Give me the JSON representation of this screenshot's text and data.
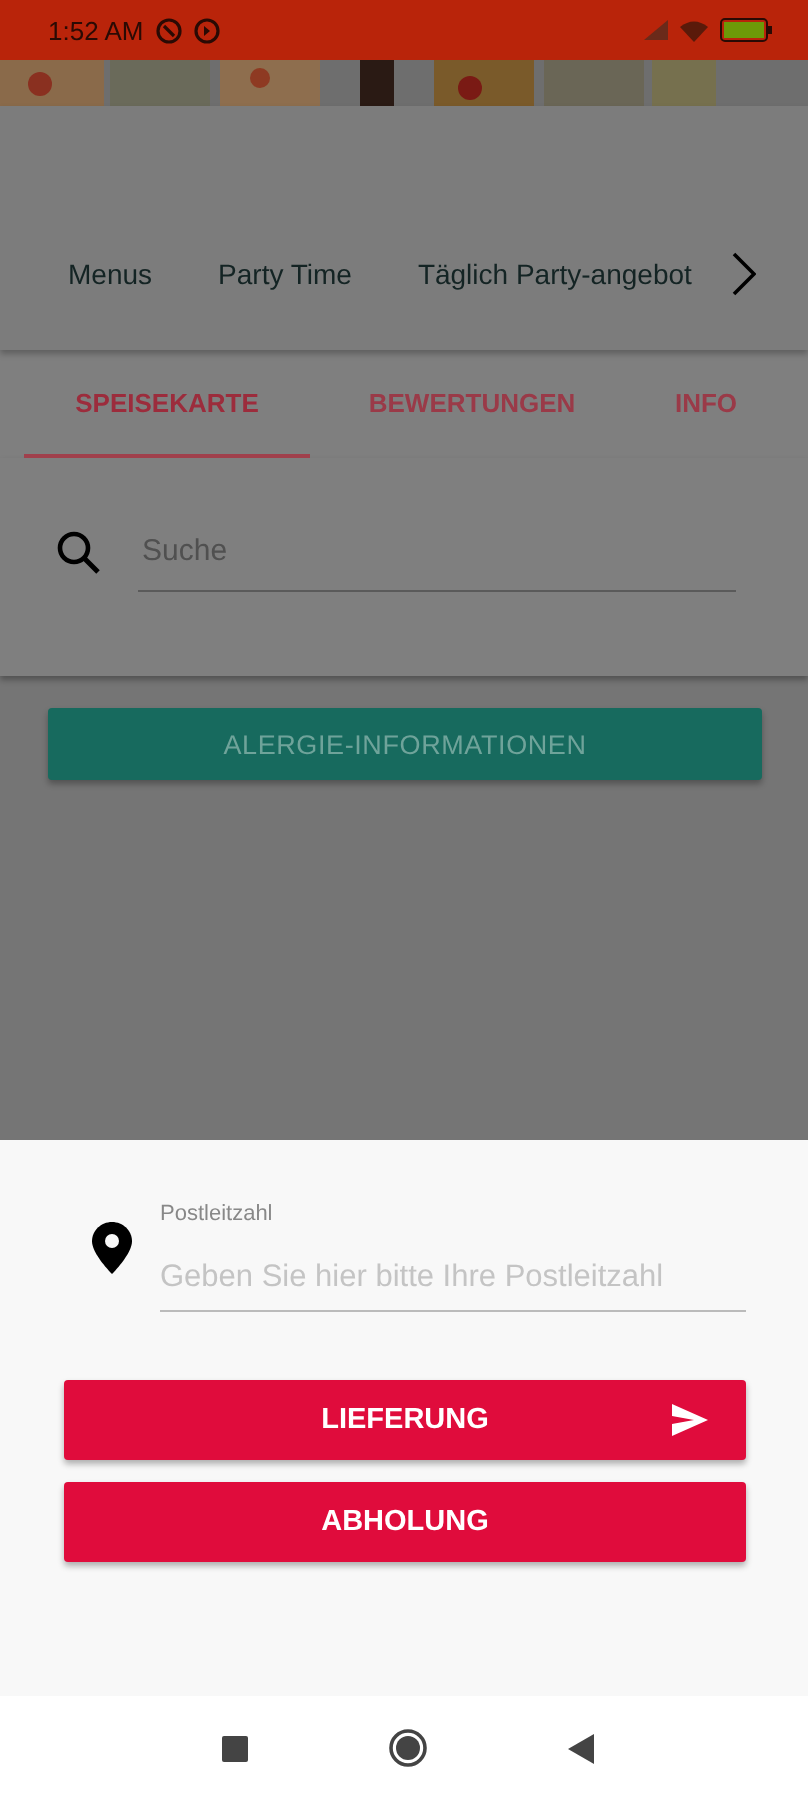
{
  "status_bar": {
    "time": "1:52 AM"
  },
  "categories": [
    {
      "label": "Menus"
    },
    {
      "label": "Party Time"
    },
    {
      "label": "Täglich Party-angebot"
    }
  ],
  "tabs": [
    {
      "label": "SPEISEKARTE",
      "selected": true
    },
    {
      "label": "BEWERTUNGEN",
      "selected": false
    },
    {
      "label": "INFO",
      "selected": false
    }
  ],
  "search": {
    "placeholder": "Suche"
  },
  "allergy_button": {
    "label": "ALERGIE-INFORMATIONEN"
  },
  "sheet": {
    "postcode": {
      "label": "Postleitzahl",
      "placeholder": "Geben Sie hier bitte Ihre Postleitzahl"
    },
    "buttons": [
      {
        "label": "LIEFERUNG",
        "kind": "send"
      },
      {
        "label": "ABHOLUNG",
        "kind": "plain"
      }
    ]
  }
}
